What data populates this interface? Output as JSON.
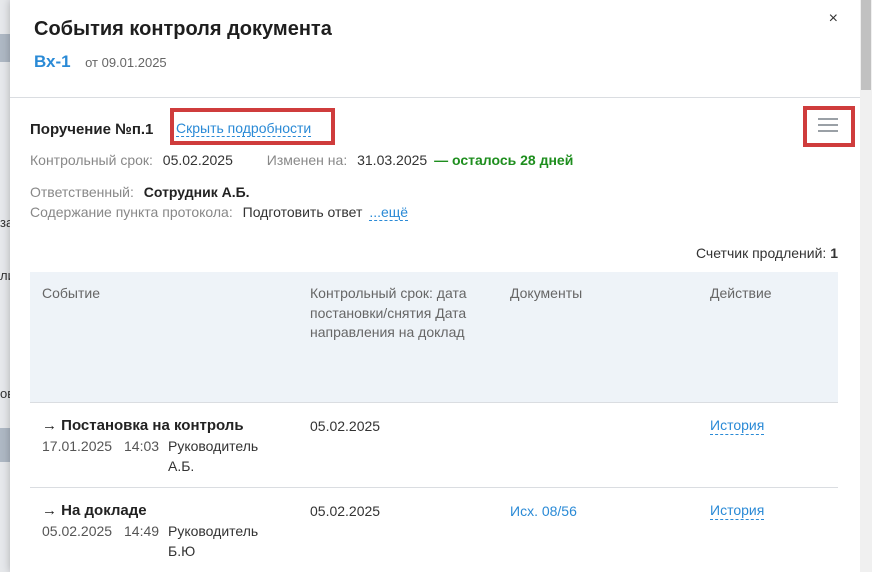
{
  "background": {
    "fragments": [
      "за",
      "ли",
      "ов"
    ]
  },
  "modal": {
    "title": "События контроля документа",
    "doc_number": "Вх-1",
    "doc_date": "от 09.01.2025",
    "close_label": "×"
  },
  "order": {
    "title": "Поручение №п.1",
    "hide_details": "Скрыть подробности",
    "control_deadline_label": "Контрольный срок:",
    "control_deadline": "05.02.2025",
    "changed_label": "Изменен на:",
    "changed_date": "31.03.2025",
    "remaining": "— осталось 28 дней",
    "responsible_label": "Ответственный:",
    "responsible": "Сотрудник А.Б.",
    "content_label": "Содержание пункта протокола:",
    "content": "Подготовить ответ",
    "more": "...ещё"
  },
  "counter": {
    "label": "Счетчик продлений:",
    "value": "1"
  },
  "table": {
    "headers": {
      "event": "Событие",
      "deadline": "Контрольный срок: дата постановки/снятия Дата направления на доклад",
      "documents": "Документы",
      "action": "Действие"
    },
    "rows": [
      {
        "title": "→ Постановка на контроль",
        "date": "17.01.2025",
        "time": "14:03",
        "person": "Руководитель А.Б.",
        "deadline": "05.02.2025",
        "document": "",
        "action": "История"
      },
      {
        "title": "→ На докладе",
        "date": "05.02.2025",
        "time": "14:49",
        "person": "Руководитель Б.Ю",
        "deadline": "05.02.2025",
        "document": "Исх. 08/56",
        "action": "История"
      }
    ]
  },
  "colors": {
    "accent": "#2a8ad6",
    "success": "#1e8e1e",
    "highlight": "#cf3c3c"
  },
  "icons": {
    "menu": "hamburger-icon",
    "close": "close-icon"
  }
}
